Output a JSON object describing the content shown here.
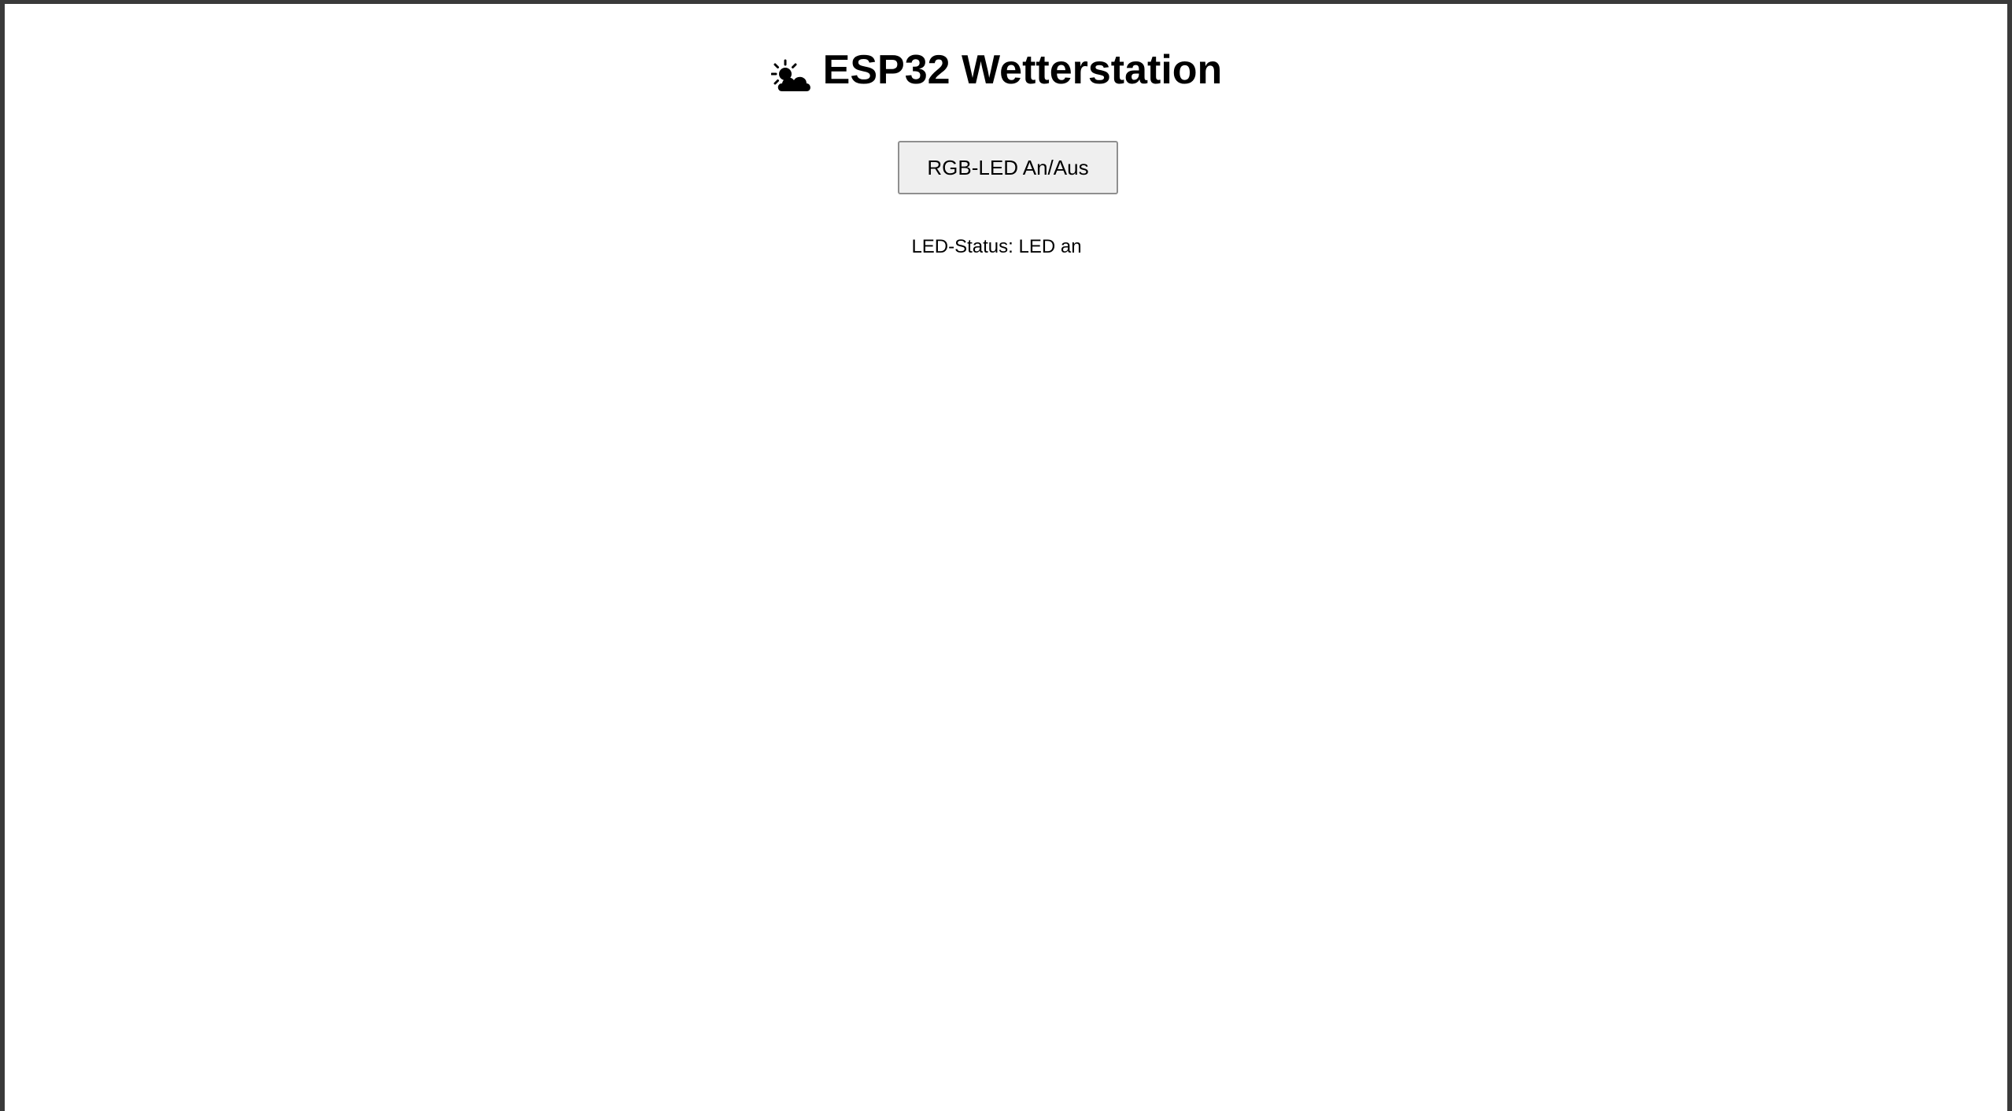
{
  "header": {
    "icon": "sun-behind-cloud-icon",
    "title": "ESP32 Wetterstation"
  },
  "controls": {
    "led_toggle_label": "RGB-LED An/Aus"
  },
  "status": {
    "label": "LED-Status:",
    "value": "LED an"
  },
  "colors": {
    "background": "#ffffff",
    "frame": "#3a3a3a",
    "button_bg": "#efefef",
    "button_border": "#8f8f8f",
    "text": "#000000"
  }
}
